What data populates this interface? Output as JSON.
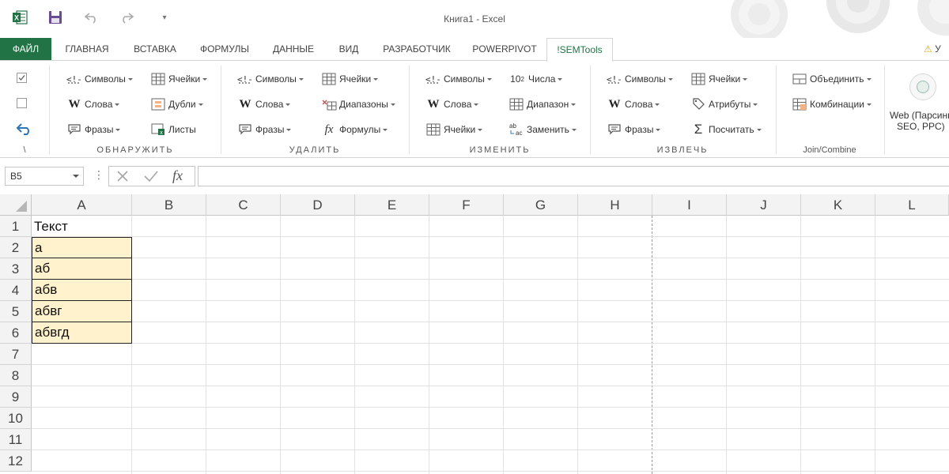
{
  "window": {
    "title": "Книга1 - Excel"
  },
  "tabs": {
    "file": "ФАЙЛ",
    "home": "ГЛАВНАЯ",
    "insert": "ВСТАВКА",
    "formulas": "ФОРМУЛЫ",
    "data": "ДАННЫЕ",
    "view": "ВИД",
    "developer": "РАЗРАБОТЧИК",
    "powerpivot": "POWERPIVOT",
    "isemtools": "!SEMTools",
    "warning_text": "У"
  },
  "ribbon": {
    "first_group_label": "\\",
    "detect": {
      "label": "ОБНАРУЖИТЬ",
      "symbols": "Символы",
      "words": "Слова",
      "phrases": "Фразы",
      "cells": "Ячейки",
      "duplicates": "Дубли",
      "sheets": "Листы"
    },
    "delete": {
      "label": "УДАЛИТЬ",
      "symbols": "Символы",
      "words": "Слова",
      "phrases": "Фразы",
      "cells": "Ячейки",
      "ranges": "Диапазоны",
      "formulas": "Формулы"
    },
    "change": {
      "label": "ИЗМЕНИТЬ",
      "symbols": "Символы",
      "words": "Слова",
      "cells": "Ячейки",
      "numbers": "Числа",
      "range": "Диапазон",
      "replace": "Заменить"
    },
    "extract": {
      "label": "ИЗВЛЕЧЬ",
      "symbols": "Символы",
      "words": "Слова",
      "phrases": "Фразы",
      "cells": "Ячейки",
      "attributes": "Атрибуты",
      "count": "Посчитать"
    },
    "join": {
      "label": "Join/Combine",
      "merge": "Объединить",
      "combinations": "Комбинации"
    },
    "web": {
      "line1": "Web (Парсинг",
      "line2": "SEO, PPC)"
    }
  },
  "formula_bar": {
    "name_box": "B5",
    "fx": "fx",
    "formula": ""
  },
  "sheet": {
    "columns": [
      "A",
      "B",
      "C",
      "D",
      "E",
      "F",
      "G",
      "H",
      "I",
      "J",
      "K",
      "L"
    ],
    "rows": [
      "1",
      "2",
      "3",
      "4",
      "5",
      "6",
      "7",
      "8",
      "9",
      "10",
      "11",
      "12"
    ],
    "cells": {
      "A1": "Текст",
      "A2": "а",
      "A3": "аб",
      "A4": "абв",
      "A5": "абвг",
      "A6": "абвгд"
    }
  }
}
